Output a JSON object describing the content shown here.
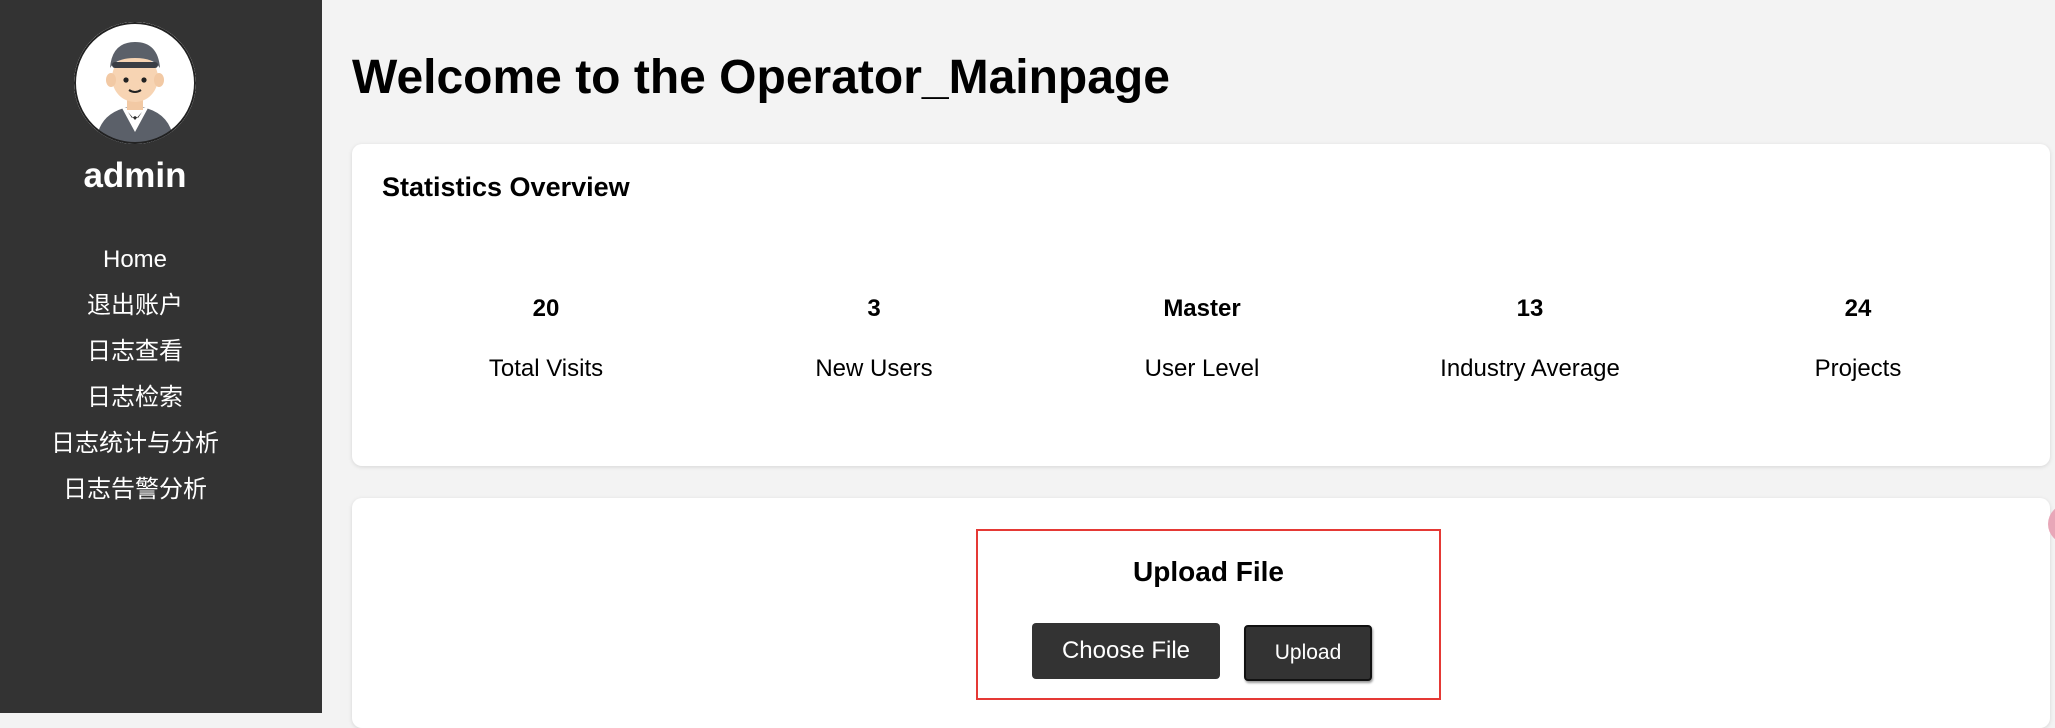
{
  "sidebar": {
    "avatar_icon": "operator-avatar-icon",
    "username": "admin",
    "items": [
      {
        "label": "Home"
      },
      {
        "label": "退出账户"
      },
      {
        "label": "日志查看"
      },
      {
        "label": "日志检索"
      },
      {
        "label": "日志统计与分析"
      },
      {
        "label": "日志告警分析"
      }
    ]
  },
  "main": {
    "title": "Welcome to the Operator_Mainpage"
  },
  "stats": {
    "title": "Statistics Overview",
    "items": [
      {
        "value": "20",
        "label": "Total Visits"
      },
      {
        "value": "3",
        "label": "New Users"
      },
      {
        "value": "Master",
        "label": "User Level"
      },
      {
        "value": "13",
        "label": "Industry Average"
      },
      {
        "value": "24",
        "label": "Projects"
      }
    ]
  },
  "upload": {
    "title": "Upload File",
    "choose_label": "Choose File",
    "upload_label": "Upload",
    "highlight_color": "#e53935"
  },
  "colors": {
    "sidebar_bg": "#333333",
    "page_bg": "#f3f3f3",
    "card_bg": "#ffffff",
    "button_bg": "#333333"
  }
}
